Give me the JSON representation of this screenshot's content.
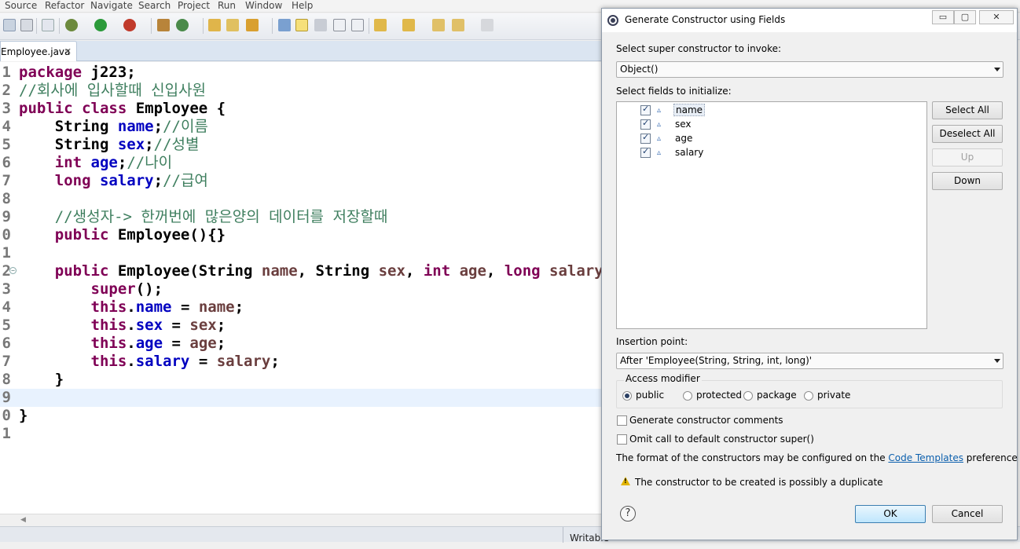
{
  "menu": [
    "Source",
    "Refactor",
    "Navigate",
    "Search",
    "Project",
    "Run",
    "Window",
    "Help"
  ],
  "editor": {
    "tab_label": "Employee.java",
    "tab_close": "✕",
    "fold_glyph": "⊖",
    "lines": [
      {
        "n": "1",
        "html": "<span class='kw'>package</span> j223;"
      },
      {
        "n": "2",
        "html": "<span class='cmt'>//회사에 입사할때 신입사원</span>"
      },
      {
        "n": "3",
        "html": "<span class='kw'>public class</span> Employee {"
      },
      {
        "n": "4",
        "html": "    String <span class='fld'>name</span>;<span class='cmt'>//이름</span>"
      },
      {
        "n": "5",
        "html": "    String <span class='fld'>sex</span>;<span class='cmt'>//성별</span>"
      },
      {
        "n": "6",
        "html": "    <span class='kw'>int</span> <span class='fld'>age</span>;<span class='cmt'>//나이</span>"
      },
      {
        "n": "7",
        "html": "    <span class='kw'>long</span> <span class='fld'>salary</span>;<span class='cmt'>//급여</span>"
      },
      {
        "n": "8",
        "html": ""
      },
      {
        "n": "9",
        "html": "    <span class='cmt'>//생성자-> 한꺼번에 많은양의 데이터를 저장할때</span>"
      },
      {
        "n": "0",
        "html": "    <span class='kw'>public</span> Employee(){}"
      },
      {
        "n": "1",
        "html": ""
      },
      {
        "n": "2",
        "html": "    <span class='kw'>public</span> Employee(String <span class='prm'>name</span>, String <span class='prm'>sex</span>, <span class='kw'>int</span> <span class='prm'>age</span>, <span class='kw'>long</span> <span class='prm'>salary</span>) {",
        "fold": true
      },
      {
        "n": "3",
        "html": "        <span class='kw'>super</span>();"
      },
      {
        "n": "4",
        "html": "        <span class='kw'>this</span>.<span class='fld'>name</span> = <span class='prm'>name</span>;"
      },
      {
        "n": "5",
        "html": "        <span class='kw'>this</span>.<span class='fld'>sex</span> = <span class='prm'>sex</span>;"
      },
      {
        "n": "6",
        "html": "        <span class='kw'>this</span>.<span class='fld'>age</span> = <span class='prm'>age</span>;"
      },
      {
        "n": "7",
        "html": "        <span class='kw'>this</span>.<span class='fld'>salary</span> = <span class='prm'>salary</span>;"
      },
      {
        "n": "8",
        "html": "    }"
      },
      {
        "n": "9",
        "html": "",
        "current": true
      },
      {
        "n": "0",
        "html": "}"
      },
      {
        "n": "1",
        "html": ""
      }
    ]
  },
  "status": {
    "writable": "Writable"
  },
  "dialog": {
    "title": "Generate Constructor using Fields",
    "min_label": "▭",
    "max_label": "▢",
    "close_label": "✕",
    "super_label": "Select super constructor to invoke:",
    "super_value": "Object()",
    "fields_label": "Select fields to initialize:",
    "field_icon": "▵",
    "fields": [
      {
        "name": "name",
        "checked": true,
        "selected": true
      },
      {
        "name": "sex",
        "checked": true
      },
      {
        "name": "age",
        "checked": true
      },
      {
        "name": "salary",
        "checked": true
      }
    ],
    "btn_select_all": "Select All",
    "btn_deselect_all": "Deselect All",
    "btn_up": "Up",
    "btn_down": "Down",
    "insertion_label": "Insertion point:",
    "insertion_value": "After 'Employee(String, String, int, long)'",
    "access_label": "Access modifier",
    "access_options": [
      "public",
      "protected",
      "package",
      "private"
    ],
    "access_selected": "public",
    "gen_comments_label": "Generate constructor comments",
    "omit_super_label": "Omit call to default constructor super()",
    "format_text_before": "The format of the constructors may be configured on the ",
    "format_link": "Code Templates",
    "format_text_after": " preference page.",
    "warning_text": "The constructor to be created is possibly a duplicate",
    "help_glyph": "?",
    "ok_label": "OK",
    "cancel_label": "Cancel"
  }
}
